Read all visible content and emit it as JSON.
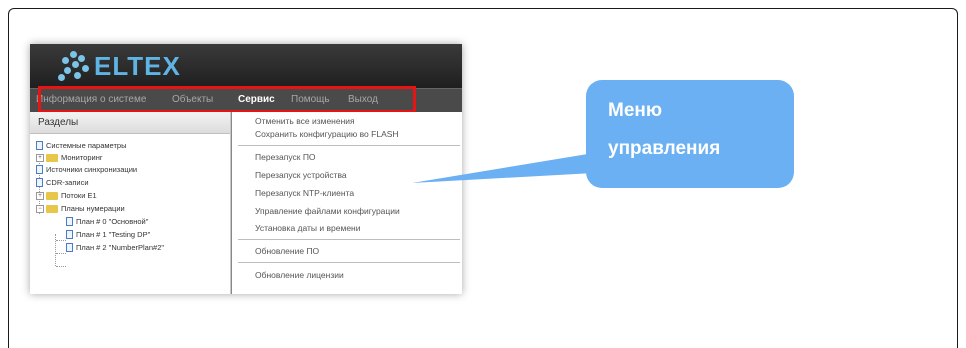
{
  "logo": {
    "text": "ELTEX"
  },
  "menu": {
    "items": [
      "Информация о системе",
      "Объекты",
      "Сервис",
      "Помощь",
      "Выход"
    ],
    "active_index": 2
  },
  "left_panel": {
    "header": "Разделы",
    "tree": [
      "Системные параметры",
      "Мониторинг",
      "Источники синхронизации",
      "CDR-записи",
      "Потоки E1",
      "Планы нумерации",
      "План # 0 \"Основной\"",
      "План # 1 \"Testing DP\"",
      "План # 2 \"NumberPlan#2\""
    ]
  },
  "service_menu": {
    "items": [
      "Отменить все изменения",
      "Сохранить конфигурацию во FLASH",
      "Перезапуск ПО",
      "Перезапуск устройства",
      "Перезапуск NTP-клиента",
      "Управление файлами конфигурации",
      "Установка даты и времени",
      "Обновление ПО",
      "Обновление лицензии"
    ]
  },
  "callout": {
    "text": "Меню\nуправления",
    "color": "#6ab0f3"
  },
  "colors": {
    "highlight_box": "#e81414",
    "logo": "#5fb4e3"
  }
}
